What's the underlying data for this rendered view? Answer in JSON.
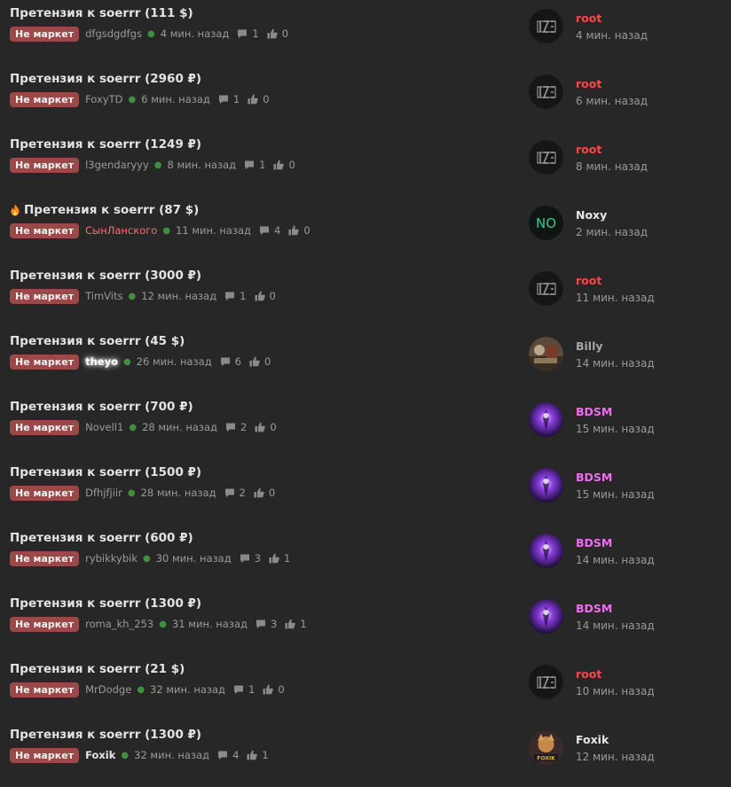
{
  "threads": [
    {
      "title": "Претензия к soerrr (111 $)",
      "hot": false,
      "badge": "Не маркет",
      "author": "dfgsdgdfgs",
      "author_style": "normal",
      "time": "4 мин. назад",
      "replies": "1",
      "likes": "0",
      "last_user": "root",
      "last_user_color": "#ff4545",
      "last_time": "4 мин. назад",
      "avatar": "logo"
    },
    {
      "title": "Претензия к soerrr (2960 ₽)",
      "hot": false,
      "badge": "Не маркет",
      "author": "FoxyTD",
      "author_style": "normal",
      "time": "6 мин. назад",
      "replies": "1",
      "likes": "0",
      "last_user": "root",
      "last_user_color": "#ff4545",
      "last_time": "6 мин. назад",
      "avatar": "logo"
    },
    {
      "title": "Претензия к soerrr (1249 ₽)",
      "hot": false,
      "badge": "Не маркет",
      "author": "l3gendaryyy",
      "author_style": "normal",
      "time": "8 мин. назад",
      "replies": "1",
      "likes": "0",
      "last_user": "root",
      "last_user_color": "#ff4545",
      "last_time": "8 мин. назад",
      "avatar": "logo"
    },
    {
      "title": "Претензия к soerrr (87 $)",
      "hot": true,
      "badge": "Не маркет",
      "author": "СынЛанского",
      "author_style": "red",
      "time": "11 мин. назад",
      "replies": "4",
      "likes": "0",
      "last_user": "Noxy",
      "last_user_color": "#e8e8e8",
      "last_time": "2 мин. назад",
      "avatar": "initials",
      "avatar_text": "NO"
    },
    {
      "title": "Претензия к soerrr (3000 ₽)",
      "hot": false,
      "badge": "Не маркет",
      "author": "TimVits",
      "author_style": "normal",
      "time": "12 мин. назад",
      "replies": "1",
      "likes": "0",
      "last_user": "root",
      "last_user_color": "#ff4545",
      "last_time": "11 мин. назад",
      "avatar": "logo"
    },
    {
      "title": "Претензия к soerrr (45 $)",
      "hot": false,
      "badge": "Не маркет",
      "author": "theyo",
      "author_style": "glow",
      "time": "26 мин. назад",
      "replies": "6",
      "likes": "0",
      "last_user": "Billy",
      "last_user_color": "#a6a6a6",
      "last_time": "14 мин. назад",
      "avatar": "photo"
    },
    {
      "title": "Претензия к soerrr (700 ₽)",
      "hot": false,
      "badge": "Не маркет",
      "author": "Novell1",
      "author_style": "normal",
      "time": "28 мин. назад",
      "replies": "2",
      "likes": "0",
      "last_user": "BDSM",
      "last_user_color": "#f06cf0",
      "last_time": "15 мин. назад",
      "avatar": "purple"
    },
    {
      "title": "Претензия к soerrr (1500 ₽)",
      "hot": false,
      "badge": "Не маркет",
      "author": "Dfhjfjiir",
      "author_style": "normal",
      "time": "28 мин. назад",
      "replies": "2",
      "likes": "0",
      "last_user": "BDSM",
      "last_user_color": "#f06cf0",
      "last_time": "15 мин. назад",
      "avatar": "purple"
    },
    {
      "title": "Претензия к soerrr (600 ₽)",
      "hot": false,
      "badge": "Не маркет",
      "author": "rybikkybik",
      "author_style": "normal",
      "time": "30 мин. назад",
      "replies": "3",
      "likes": "1",
      "last_user": "BDSM",
      "last_user_color": "#f06cf0",
      "last_time": "14 мин. назад",
      "avatar": "purple"
    },
    {
      "title": "Претензия к soerrr (1300 ₽)",
      "hot": false,
      "badge": "Не маркет",
      "author": "roma_kh_253",
      "author_style": "normal",
      "time": "31 мин. назад",
      "replies": "3",
      "likes": "1",
      "last_user": "BDSM",
      "last_user_color": "#f06cf0",
      "last_time": "14 мин. назад",
      "avatar": "purple"
    },
    {
      "title": "Претензия к soerrr (21 $)",
      "hot": false,
      "badge": "Не маркет",
      "author": "MrDodge",
      "author_style": "normal",
      "time": "32 мин. назад",
      "replies": "1",
      "likes": "0",
      "last_user": "root",
      "last_user_color": "#ff4545",
      "last_time": "10 мин. назад",
      "avatar": "logo"
    },
    {
      "title": "Претензия к soerrr (1300 ₽)",
      "hot": false,
      "badge": "Не маркет",
      "author": "Foxik",
      "author_style": "bold",
      "time": "32 мин. назад",
      "replies": "4",
      "likes": "1",
      "last_user": "Foxik",
      "last_user_color": "#e8e8e8",
      "last_time": "12 мин. назад",
      "avatar": "game",
      "avatar_caption": "FOXIK"
    }
  ]
}
